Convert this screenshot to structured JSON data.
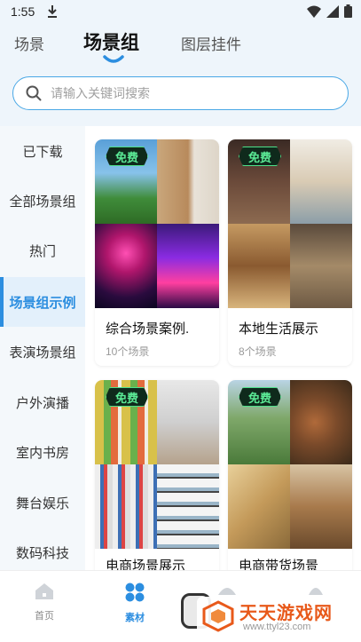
{
  "status": {
    "time": "1:55"
  },
  "top_tabs": [
    {
      "label": "场景"
    },
    {
      "label": "场景组"
    },
    {
      "label": "图层挂件"
    }
  ],
  "search": {
    "placeholder": "请输入关键词搜索"
  },
  "sidebar": {
    "items": [
      {
        "label": "已下载"
      },
      {
        "label": "全部场景组"
      },
      {
        "label": "热门"
      },
      {
        "label": "场景组示例",
        "active": true
      },
      {
        "label": "表演场景组"
      },
      {
        "label": "户外演播"
      },
      {
        "label": "室内书房"
      },
      {
        "label": "舞台娱乐"
      },
      {
        "label": "数码科技"
      }
    ]
  },
  "cards": [
    {
      "badge": "免费",
      "title": "综合场景案例.",
      "count": "10个场景"
    },
    {
      "badge": "免费",
      "title": "本地生活展示",
      "count": "8个场景"
    },
    {
      "badge": "免费",
      "title": "电商场景展示",
      "count": ""
    },
    {
      "badge": "免费",
      "title": "电商带货场景",
      "count": ""
    }
  ],
  "bottom_nav": [
    {
      "label": "首页"
    },
    {
      "label": "素材",
      "active": true
    }
  ],
  "watermark": {
    "title": "天天游戏网",
    "url": "www.ttyl23.com"
  },
  "colors": {
    "accent": "#2c8ee0",
    "badge_green": "#5bea96",
    "watermark_orange": "#e8591a"
  }
}
